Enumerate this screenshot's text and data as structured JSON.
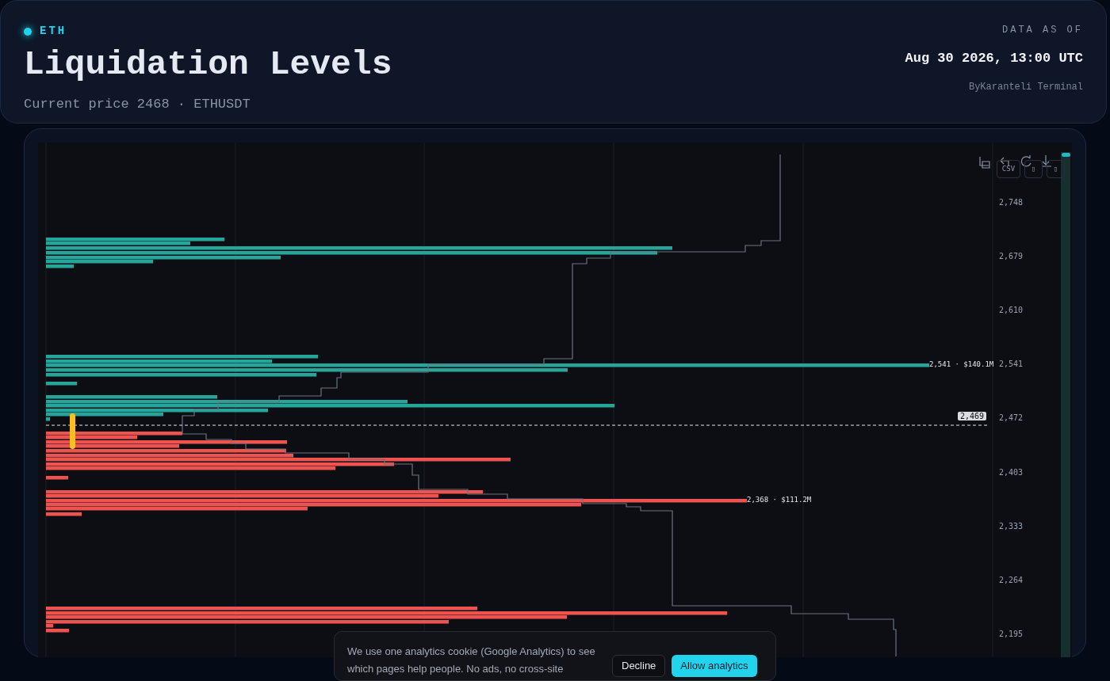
{
  "header": {
    "tag": "ETH",
    "title": "Liquidation Levels",
    "subtitle": "Current price 2468 · ETHUSDT",
    "data_as_of_label": "DATA AS OF",
    "timestamp": "Aug 30 2026, 13:00 UTC",
    "source": "ByKaranteli Terminal"
  },
  "chart": {
    "toolbar_buttons": [
      "CSV",
      "▯",
      "▯"
    ],
    "y_ticks": [
      "2,748",
      "2,679",
      "2,610",
      "2,541",
      "2,472",
      "2,403",
      "2,333",
      "2,264",
      "2,195"
    ],
    "current_price_tag": "2,469",
    "annotations": [
      "2,541 · $140.1M",
      "2,368 · $111.2M"
    ]
  },
  "cookie_banner": {
    "text": "We use one analytics cookie (Google Analytics) to see which pages help people. No ads, no cross-site",
    "buttons": [
      {
        "label": "Decline",
        "kind": "secondary"
      },
      {
        "label": "Allow analytics",
        "kind": "primary"
      }
    ]
  }
}
